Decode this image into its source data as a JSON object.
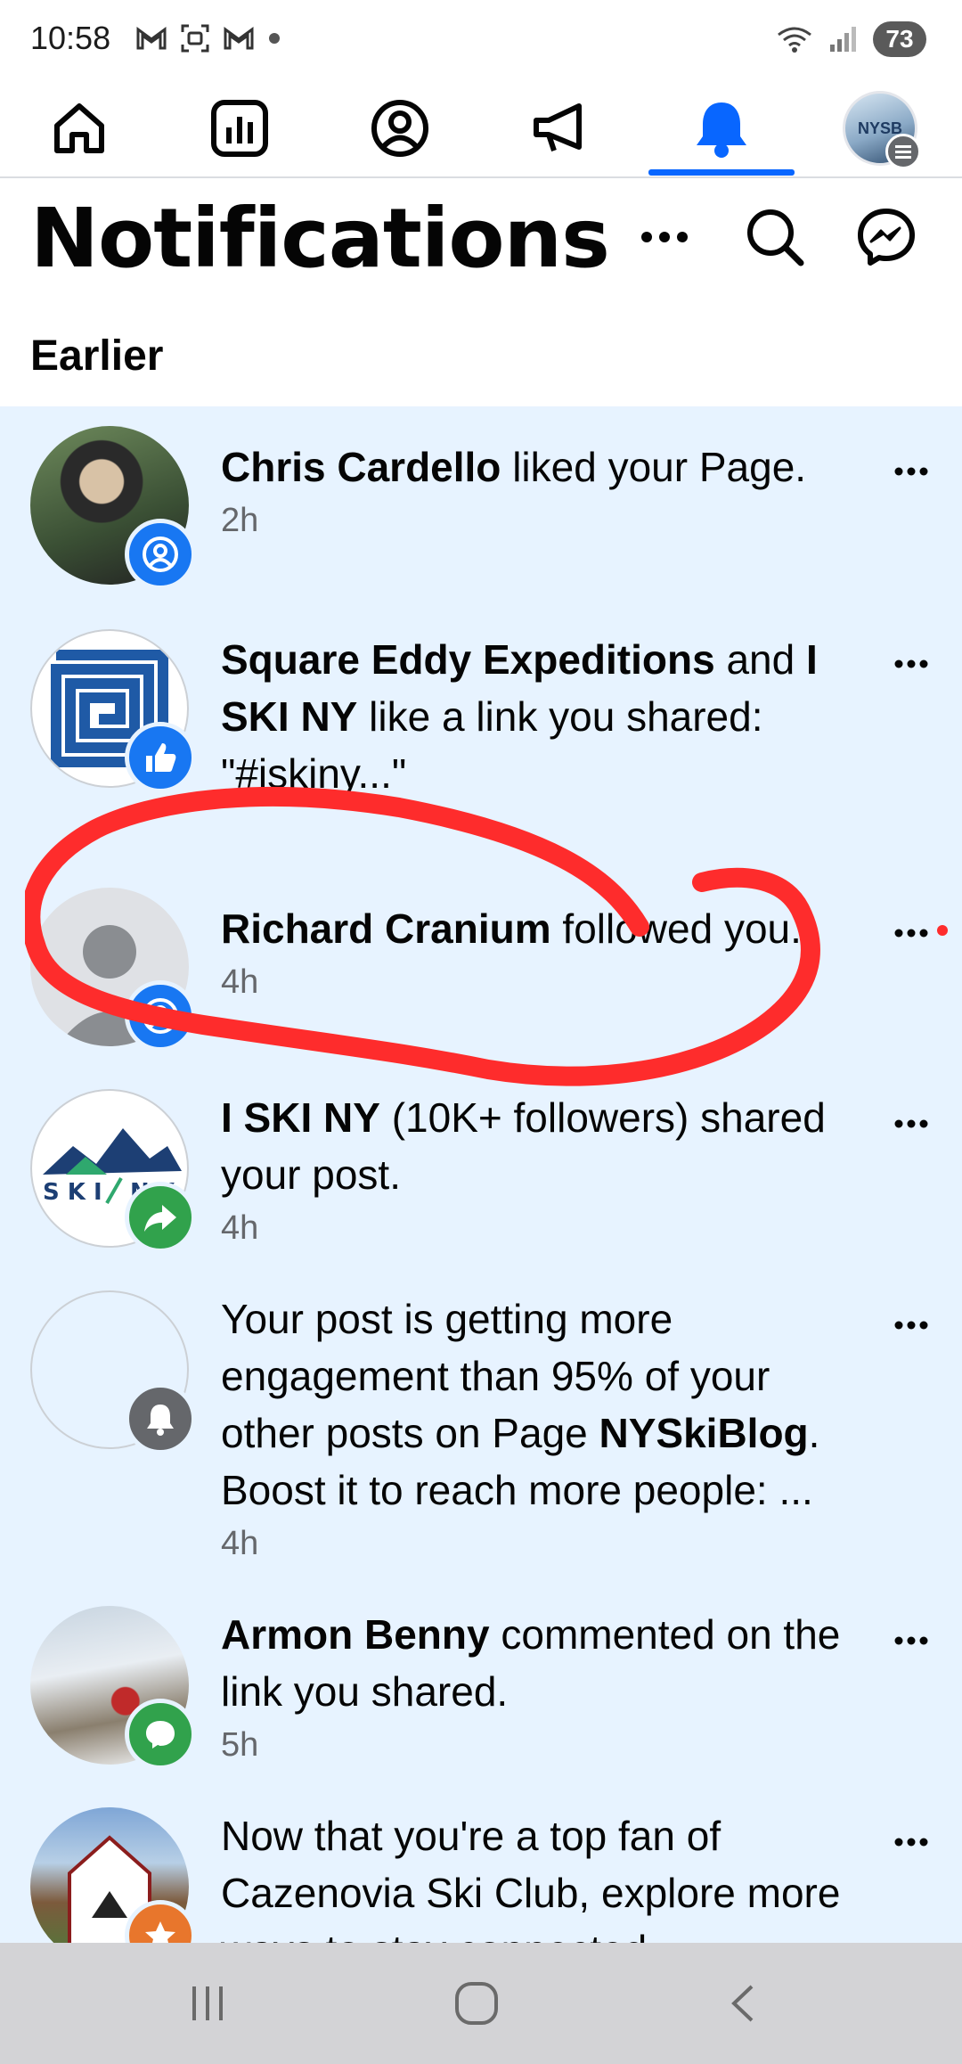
{
  "status_bar": {
    "time": "10:58",
    "battery": "73"
  },
  "nav": {
    "items": [
      {
        "icon": "home-icon"
      },
      {
        "icon": "dashboard-icon"
      },
      {
        "icon": "profile-icon"
      },
      {
        "icon": "megaphone-icon"
      },
      {
        "icon": "bell-icon",
        "active": true
      }
    ],
    "avatar_label": "NYSB",
    "accent": "#0866ff"
  },
  "header": {
    "title": "Notifications",
    "section": "Earlier"
  },
  "notifications": [
    {
      "actor": "Chris Cardello",
      "text": " liked your Page.",
      "time": "2h",
      "badge_icon": "follow-icon",
      "badge_color": "#1877f2"
    },
    {
      "actor": "Square Eddy Expeditions",
      "mid": " and ",
      "actor2": "I SKI NY",
      "text": " like a link you shared: \"#iskiny...\"",
      "time": "",
      "badge_icon": "like-icon",
      "badge_color": "#1877f2"
    },
    {
      "actor": "Richard Cranium",
      "text": " followed you.",
      "time": "4h",
      "badge_icon": "follow-icon",
      "badge_color": "#1877f2"
    },
    {
      "actor": "I SKI NY",
      "text": " (10K+ followers) shared your post.",
      "time": "4h",
      "badge_icon": "share-icon",
      "badge_color": "#31a24c"
    },
    {
      "text_before": "Your post is getting more engagement than 95% of your other posts on Page ",
      "page": "NYSkiBlog",
      "text_after": ". Boost it to reach more people: ...",
      "time": "4h",
      "badge_icon": "bell-icon",
      "badge_color": "#65676b"
    },
    {
      "actor": "Armon Benny",
      "text": " commented on the link you shared.",
      "time": "5h",
      "badge_icon": "comment-icon",
      "badge_color": "#31a24c"
    },
    {
      "text": "Now that you're a top fan of Cazenovia Ski Club, explore more ways to stay connected.",
      "badge_icon": "star-icon",
      "badge_color": "#e8762c"
    }
  ],
  "annotation_color": "#fe2c2c"
}
